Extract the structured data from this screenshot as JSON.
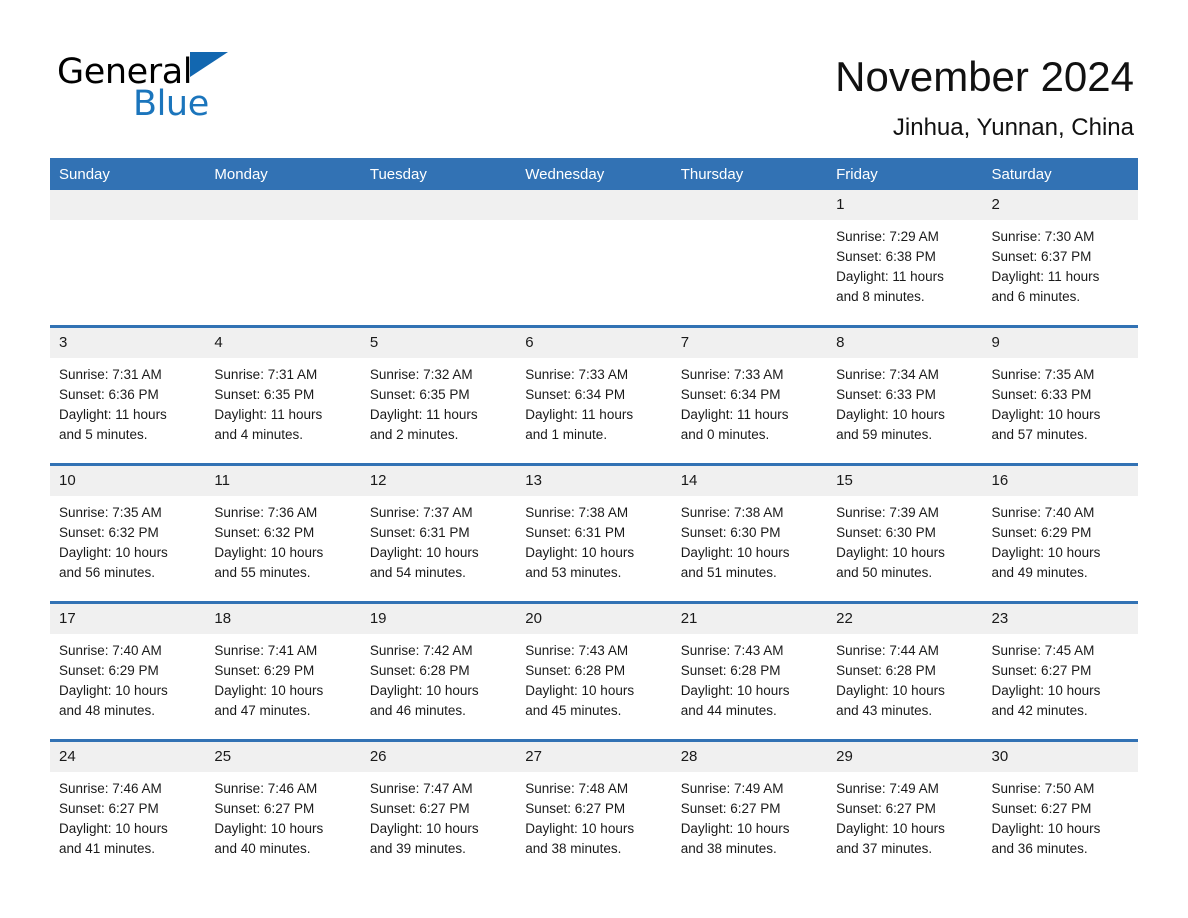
{
  "brand": {
    "name_part1": "General",
    "name_part2": "Blue",
    "triangle_color": "#1267b0",
    "blue_color": "#1b75bc"
  },
  "header": {
    "month_title": "November 2024",
    "location": "Jinhua, Yunnan, China"
  },
  "theme": {
    "header_bg": "#3272b4",
    "header_text": "#ffffff",
    "daynum_bg": "#f0f0f0",
    "cell_bg": "#ffffff",
    "row_divider": "#3272b4"
  },
  "weekdays": [
    "Sunday",
    "Monday",
    "Tuesday",
    "Wednesday",
    "Thursday",
    "Friday",
    "Saturday"
  ],
  "labels": {
    "sunrise_prefix": "Sunrise:",
    "sunset_prefix": "Sunset:",
    "daylight_prefix": "Daylight:"
  },
  "weeks": [
    [
      {
        "day": "",
        "empty": true
      },
      {
        "day": "",
        "empty": true
      },
      {
        "day": "",
        "empty": true
      },
      {
        "day": "",
        "empty": true
      },
      {
        "day": "",
        "empty": true
      },
      {
        "day": "1",
        "sunrise": "Sunrise: 7:29 AM",
        "sunset": "Sunset: 6:38 PM",
        "daylight_1": "Daylight: 11 hours",
        "daylight_2": "and 8 minutes."
      },
      {
        "day": "2",
        "sunrise": "Sunrise: 7:30 AM",
        "sunset": "Sunset: 6:37 PM",
        "daylight_1": "Daylight: 11 hours",
        "daylight_2": "and 6 minutes."
      }
    ],
    [
      {
        "day": "3",
        "sunrise": "Sunrise: 7:31 AM",
        "sunset": "Sunset: 6:36 PM",
        "daylight_1": "Daylight: 11 hours",
        "daylight_2": "and 5 minutes."
      },
      {
        "day": "4",
        "sunrise": "Sunrise: 7:31 AM",
        "sunset": "Sunset: 6:35 PM",
        "daylight_1": "Daylight: 11 hours",
        "daylight_2": "and 4 minutes."
      },
      {
        "day": "5",
        "sunrise": "Sunrise: 7:32 AM",
        "sunset": "Sunset: 6:35 PM",
        "daylight_1": "Daylight: 11 hours",
        "daylight_2": "and 2 minutes."
      },
      {
        "day": "6",
        "sunrise": "Sunrise: 7:33 AM",
        "sunset": "Sunset: 6:34 PM",
        "daylight_1": "Daylight: 11 hours",
        "daylight_2": "and 1 minute."
      },
      {
        "day": "7",
        "sunrise": "Sunrise: 7:33 AM",
        "sunset": "Sunset: 6:34 PM",
        "daylight_1": "Daylight: 11 hours",
        "daylight_2": "and 0 minutes."
      },
      {
        "day": "8",
        "sunrise": "Sunrise: 7:34 AM",
        "sunset": "Sunset: 6:33 PM",
        "daylight_1": "Daylight: 10 hours",
        "daylight_2": "and 59 minutes."
      },
      {
        "day": "9",
        "sunrise": "Sunrise: 7:35 AM",
        "sunset": "Sunset: 6:33 PM",
        "daylight_1": "Daylight: 10 hours",
        "daylight_2": "and 57 minutes."
      }
    ],
    [
      {
        "day": "10",
        "sunrise": "Sunrise: 7:35 AM",
        "sunset": "Sunset: 6:32 PM",
        "daylight_1": "Daylight: 10 hours",
        "daylight_2": "and 56 minutes."
      },
      {
        "day": "11",
        "sunrise": "Sunrise: 7:36 AM",
        "sunset": "Sunset: 6:32 PM",
        "daylight_1": "Daylight: 10 hours",
        "daylight_2": "and 55 minutes."
      },
      {
        "day": "12",
        "sunrise": "Sunrise: 7:37 AM",
        "sunset": "Sunset: 6:31 PM",
        "daylight_1": "Daylight: 10 hours",
        "daylight_2": "and 54 minutes."
      },
      {
        "day": "13",
        "sunrise": "Sunrise: 7:38 AM",
        "sunset": "Sunset: 6:31 PM",
        "daylight_1": "Daylight: 10 hours",
        "daylight_2": "and 53 minutes."
      },
      {
        "day": "14",
        "sunrise": "Sunrise: 7:38 AM",
        "sunset": "Sunset: 6:30 PM",
        "daylight_1": "Daylight: 10 hours",
        "daylight_2": "and 51 minutes."
      },
      {
        "day": "15",
        "sunrise": "Sunrise: 7:39 AM",
        "sunset": "Sunset: 6:30 PM",
        "daylight_1": "Daylight: 10 hours",
        "daylight_2": "and 50 minutes."
      },
      {
        "day": "16",
        "sunrise": "Sunrise: 7:40 AM",
        "sunset": "Sunset: 6:29 PM",
        "daylight_1": "Daylight: 10 hours",
        "daylight_2": "and 49 minutes."
      }
    ],
    [
      {
        "day": "17",
        "sunrise": "Sunrise: 7:40 AM",
        "sunset": "Sunset: 6:29 PM",
        "daylight_1": "Daylight: 10 hours",
        "daylight_2": "and 48 minutes."
      },
      {
        "day": "18",
        "sunrise": "Sunrise: 7:41 AM",
        "sunset": "Sunset: 6:29 PM",
        "daylight_1": "Daylight: 10 hours",
        "daylight_2": "and 47 minutes."
      },
      {
        "day": "19",
        "sunrise": "Sunrise: 7:42 AM",
        "sunset": "Sunset: 6:28 PM",
        "daylight_1": "Daylight: 10 hours",
        "daylight_2": "and 46 minutes."
      },
      {
        "day": "20",
        "sunrise": "Sunrise: 7:43 AM",
        "sunset": "Sunset: 6:28 PM",
        "daylight_1": "Daylight: 10 hours",
        "daylight_2": "and 45 minutes."
      },
      {
        "day": "21",
        "sunrise": "Sunrise: 7:43 AM",
        "sunset": "Sunset: 6:28 PM",
        "daylight_1": "Daylight: 10 hours",
        "daylight_2": "and 44 minutes."
      },
      {
        "day": "22",
        "sunrise": "Sunrise: 7:44 AM",
        "sunset": "Sunset: 6:28 PM",
        "daylight_1": "Daylight: 10 hours",
        "daylight_2": "and 43 minutes."
      },
      {
        "day": "23",
        "sunrise": "Sunrise: 7:45 AM",
        "sunset": "Sunset: 6:27 PM",
        "daylight_1": "Daylight: 10 hours",
        "daylight_2": "and 42 minutes."
      }
    ],
    [
      {
        "day": "24",
        "sunrise": "Sunrise: 7:46 AM",
        "sunset": "Sunset: 6:27 PM",
        "daylight_1": "Daylight: 10 hours",
        "daylight_2": "and 41 minutes."
      },
      {
        "day": "25",
        "sunrise": "Sunrise: 7:46 AM",
        "sunset": "Sunset: 6:27 PM",
        "daylight_1": "Daylight: 10 hours",
        "daylight_2": "and 40 minutes."
      },
      {
        "day": "26",
        "sunrise": "Sunrise: 7:47 AM",
        "sunset": "Sunset: 6:27 PM",
        "daylight_1": "Daylight: 10 hours",
        "daylight_2": "and 39 minutes."
      },
      {
        "day": "27",
        "sunrise": "Sunrise: 7:48 AM",
        "sunset": "Sunset: 6:27 PM",
        "daylight_1": "Daylight: 10 hours",
        "daylight_2": "and 38 minutes."
      },
      {
        "day": "28",
        "sunrise": "Sunrise: 7:49 AM",
        "sunset": "Sunset: 6:27 PM",
        "daylight_1": "Daylight: 10 hours",
        "daylight_2": "and 38 minutes."
      },
      {
        "day": "29",
        "sunrise": "Sunrise: 7:49 AM",
        "sunset": "Sunset: 6:27 PM",
        "daylight_1": "Daylight: 10 hours",
        "daylight_2": "and 37 minutes."
      },
      {
        "day": "30",
        "sunrise": "Sunrise: 7:50 AM",
        "sunset": "Sunset: 6:27 PM",
        "daylight_1": "Daylight: 10 hours",
        "daylight_2": "and 36 minutes."
      }
    ]
  ]
}
